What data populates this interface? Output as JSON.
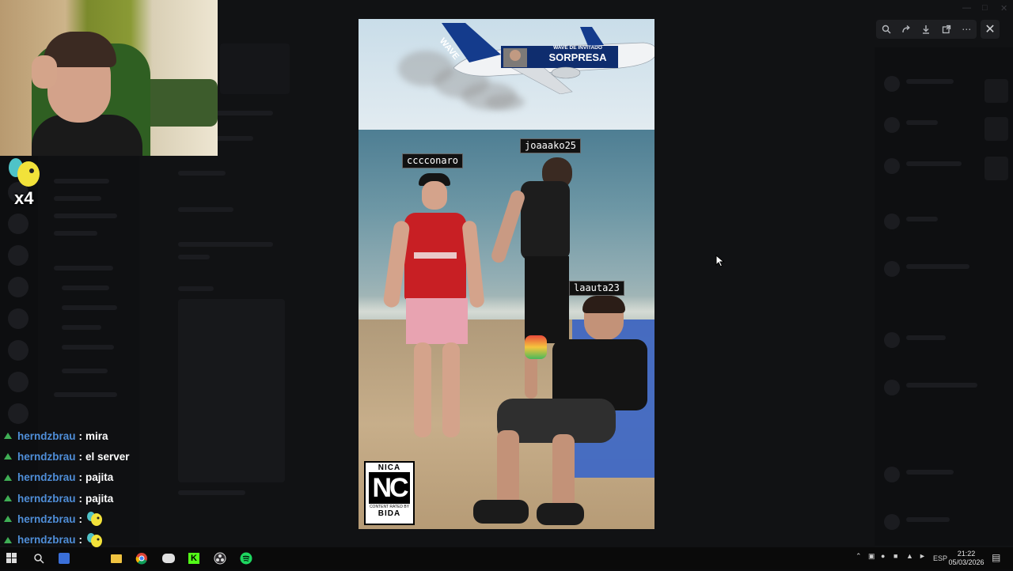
{
  "viewer": {
    "toolbar": {
      "zoom_icon": "zoom-icon",
      "forward_icon": "forward-icon",
      "download_icon": "download-icon",
      "open_external_icon": "open-external-icon",
      "more_icon": "more-icon"
    },
    "close_icon": "close-icon"
  },
  "image": {
    "plane_text_top": "WAVE DE INVITADO",
    "plane_text_main": "SORPRESA",
    "plane_tail_text": "WAVE",
    "name_tags": [
      "cccconaro",
      "joaaako25",
      "laauta23"
    ],
    "rating_badge": {
      "top": "NICA",
      "letters": "NC",
      "subtext": "CONTENT RATED BY",
      "bottom": "BIDA"
    }
  },
  "emote_overlay": {
    "count": "x4"
  },
  "chat": {
    "messages": [
      {
        "user": "herndzbrau",
        "sep": ":",
        "text": "mira",
        "emote": false
      },
      {
        "user": "herndzbrau",
        "sep": ":",
        "text": "el server",
        "emote": false
      },
      {
        "user": "herndzbrau",
        "sep": ":",
        "text": "pajita",
        "emote": false
      },
      {
        "user": "herndzbrau",
        "sep": ":",
        "text": "pajita",
        "emote": false
      },
      {
        "user": "herndzbrau",
        "sep": ":",
        "text": "",
        "emote": true
      },
      {
        "user": "herndzbrau",
        "sep": ":",
        "text": "",
        "emote": true
      },
      {
        "user": "herndzbrau",
        "sep": ":",
        "text": "",
        "emote": true
      }
    ]
  },
  "taskbar": {
    "language": "ESP",
    "time": "21:22",
    "date": "05/03/2026"
  },
  "colors": {
    "chat_user": "#4f8ed8",
    "background": "#0c0c0e",
    "viewer_toolbar": "#1e1f22"
  }
}
